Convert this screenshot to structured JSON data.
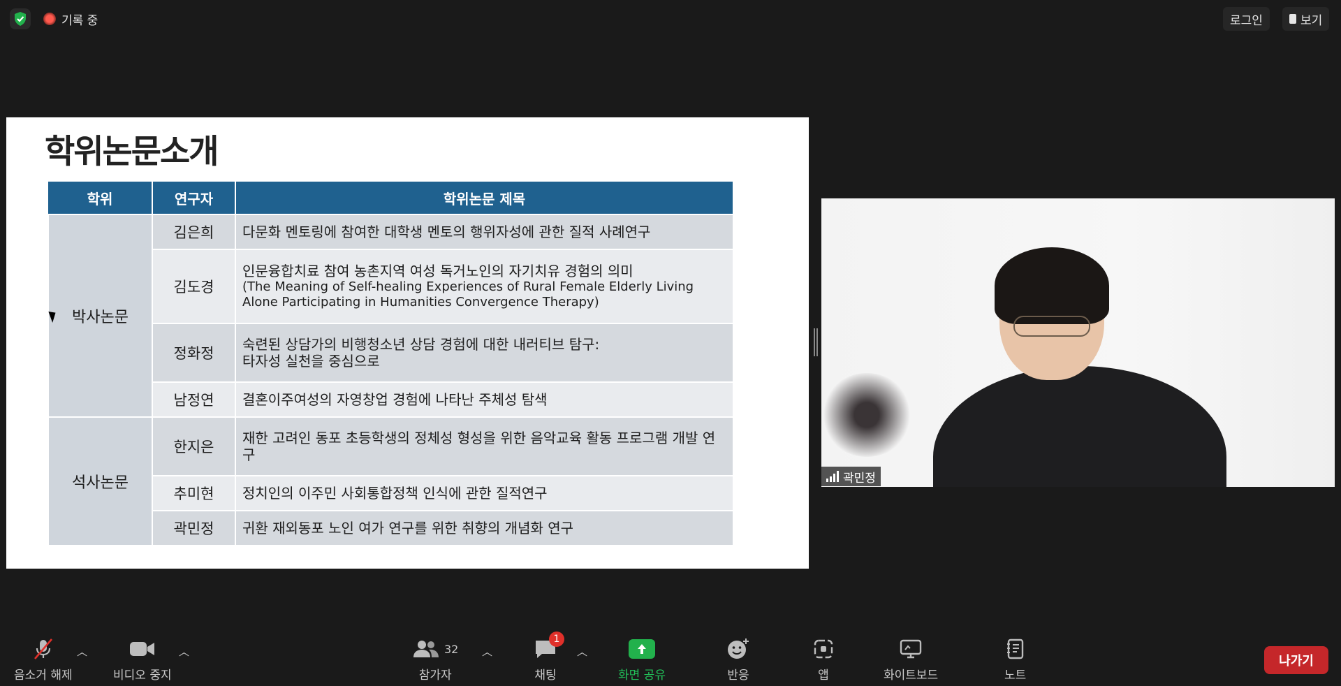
{
  "top_bar": {
    "recording_label": "기록 중",
    "login_label": "로그인",
    "view_label": "보기"
  },
  "slide": {
    "title": "학위논문소개",
    "headers": [
      "학위",
      "연구자",
      "학위논문 제목"
    ],
    "groups": [
      {
        "degree": "박사논문",
        "rows": [
          {
            "name": "김은희",
            "title": "다문화 멘토링에 참여한 대학생 멘토의 행위자성에 관한 질적 사례연구"
          },
          {
            "name": "김도경",
            "title": "인문융합치료 참여 농촌지역 여성 독거노인의 자기치유 경험의 의미",
            "title_en": "(The Meaning of Self-healing Experiences of Rural Female Elderly Living Alone Participating in Humanities Convergence Therapy)"
          },
          {
            "name": "정화정",
            "title": "숙련된 상담가의 비행청소년 상담 경험에 대한 내러티브 탐구:",
            "title2": "타자성 실천을 중심으로"
          },
          {
            "name": "남정연",
            "title": "결혼이주여성의 자영창업 경험에 나타난 주체성 탐색"
          }
        ]
      },
      {
        "degree": "석사논문",
        "rows": [
          {
            "name": "한지은",
            "title": "재한 고려인 동포 초등학생의 정체성 형성을 위한 음악교육 활동 프로그램 개발 연구"
          },
          {
            "name": "추미현",
            "title": "정치인의 이주민 사회통합정책 인식에 관한 질적연구"
          },
          {
            "name": "곽민정",
            "title": "귀환 재외동포 노인 여가 연구를 위한 취향의 개념화 연구"
          }
        ]
      }
    ]
  },
  "video": {
    "participant_name": "곽민정"
  },
  "toolbar": {
    "unmute_label": "음소거 해제",
    "stop_video_label": "비디오 중지",
    "participants_label": "참가자",
    "participants_count": "32",
    "chat_label": "채팅",
    "chat_badge": "1",
    "share_label": "화면 공유",
    "reactions_label": "반응",
    "apps_label": "앱",
    "whiteboard_label": "화이트보드",
    "notes_label": "노트",
    "leave_label": "나가기"
  },
  "colors": {
    "table_header": "#1f618f",
    "share_green": "#22b14c",
    "leave_red": "#c5272a",
    "badge_red": "#e0302a"
  }
}
